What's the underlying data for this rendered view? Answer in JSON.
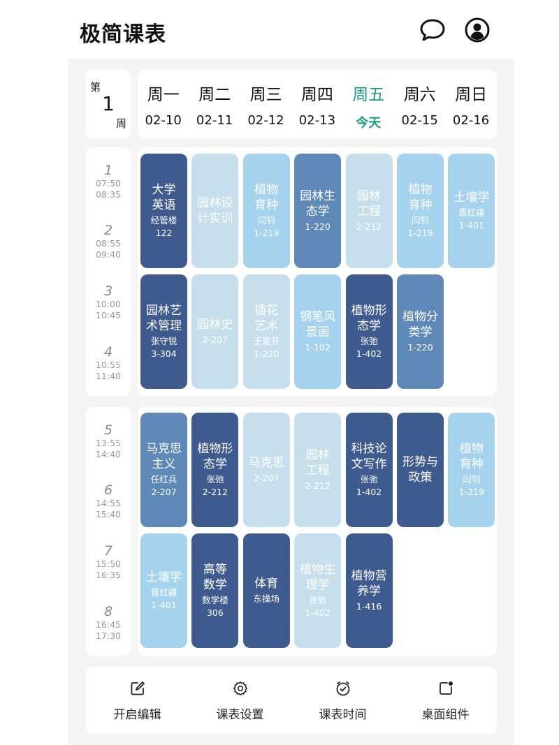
{
  "app": {
    "title": "极简课表"
  },
  "week": {
    "prefix": "第",
    "number": "1",
    "suffix": "周"
  },
  "days": [
    {
      "name": "周一",
      "date": "02-10"
    },
    {
      "name": "周二",
      "date": "02-11"
    },
    {
      "name": "周三",
      "date": "02-12"
    },
    {
      "name": "周四",
      "date": "02-13"
    },
    {
      "name": "周五",
      "date": "今天",
      "today": true
    },
    {
      "name": "周六",
      "date": "02-15"
    },
    {
      "name": "周日",
      "date": "02-16"
    }
  ],
  "periods": [
    {
      "num": "1",
      "start": "07:50",
      "end": "08:35"
    },
    {
      "num": "2",
      "start": "08:55",
      "end": "09:40"
    },
    {
      "num": "3",
      "start": "10:00",
      "end": "10:45"
    },
    {
      "num": "4",
      "start": "10:55",
      "end": "11:40"
    },
    {
      "num": "5",
      "start": "13:55",
      "end": "14:40"
    },
    {
      "num": "6",
      "start": "14:55",
      "end": "15:40"
    },
    {
      "num": "7",
      "start": "15:50",
      "end": "16:35"
    },
    {
      "num": "8",
      "start": "16:45",
      "end": "17:30"
    }
  ],
  "courses": [
    {
      "day": 0,
      "slot": 0,
      "name": "大学英语",
      "teacher": "经管楼",
      "room": "122",
      "color": "navy"
    },
    {
      "day": 1,
      "slot": 0,
      "name": "园林设计实训",
      "teacher": "",
      "room": "",
      "color": "pale"
    },
    {
      "day": 2,
      "slot": 0,
      "name": "植物育种",
      "teacher": "闫钊",
      "room": "1-219",
      "color": "sky"
    },
    {
      "day": 3,
      "slot": 0,
      "name": "园林生态学",
      "teacher": "",
      "room": "1-220",
      "color": "mid"
    },
    {
      "day": 4,
      "slot": 0,
      "name": "园林工程",
      "teacher": "",
      "room": "2-212",
      "color": "pale"
    },
    {
      "day": 5,
      "slot": 0,
      "name": "植物育种",
      "teacher": "闫钊",
      "room": "1-219",
      "color": "sky"
    },
    {
      "day": 6,
      "slot": 0,
      "name": "土壤学",
      "teacher": "晋红疆",
      "room": "1-401",
      "color": "sky"
    },
    {
      "day": 0,
      "slot": 1,
      "name": "园林艺术管理",
      "teacher": "张守锐",
      "room": "3-304",
      "color": "navy"
    },
    {
      "day": 1,
      "slot": 1,
      "name": "园林史",
      "teacher": "",
      "room": "2-207",
      "color": "pale"
    },
    {
      "day": 2,
      "slot": 1,
      "name": "插花艺术",
      "teacher": "王爱芬",
      "room": "1-220",
      "color": "pale"
    },
    {
      "day": 3,
      "slot": 1,
      "name": "钢笔风景画",
      "teacher": "",
      "room": "1-102",
      "color": "sky"
    },
    {
      "day": 4,
      "slot": 1,
      "name": "植物形态学",
      "teacher": "张弛",
      "room": "1-402",
      "color": "navy"
    },
    {
      "day": 5,
      "slot": 1,
      "name": "植物分类学",
      "teacher": "",
      "room": "1-220",
      "color": "mid"
    },
    {
      "day": 0,
      "slot": 2,
      "name": "马克思主义",
      "teacher": "任红兵",
      "room": "2-207",
      "color": "mid"
    },
    {
      "day": 1,
      "slot": 2,
      "name": "植物形态学",
      "teacher": "张弛",
      "room": "2-212",
      "color": "navy"
    },
    {
      "day": 2,
      "slot": 2,
      "name": "马克思",
      "teacher": "",
      "room": "2-207",
      "color": "pale"
    },
    {
      "day": 3,
      "slot": 2,
      "name": "园林工程",
      "teacher": "",
      "room": "2-212",
      "color": "pale"
    },
    {
      "day": 4,
      "slot": 2,
      "name": "科技论文写作",
      "teacher": "张弛",
      "room": "1-402",
      "color": "navy"
    },
    {
      "day": 5,
      "slot": 2,
      "name": "形势与政策",
      "teacher": "",
      "room": "",
      "color": "navy"
    },
    {
      "day": 6,
      "slot": 2,
      "name": "植物育种",
      "teacher": "闫钊",
      "room": "1-219",
      "color": "sky"
    },
    {
      "day": 0,
      "slot": 3,
      "name": "土壤学",
      "teacher": "晋红疆",
      "room": "1-401",
      "color": "sky"
    },
    {
      "day": 1,
      "slot": 3,
      "name": "高等数学",
      "teacher": "数学楼",
      "room": "306",
      "color": "navy"
    },
    {
      "day": 2,
      "slot": 3,
      "name": "体育",
      "teacher": "东操场",
      "room": "",
      "color": "navy"
    },
    {
      "day": 3,
      "slot": 3,
      "name": "植物生理学",
      "teacher": "张弛",
      "room": "1-402",
      "color": "pale"
    },
    {
      "day": 4,
      "slot": 3,
      "name": "植物营养学",
      "teacher": "",
      "room": "1-416",
      "color": "navy"
    }
  ],
  "actions": [
    {
      "label": "开启编辑",
      "icon": "edit-icon"
    },
    {
      "label": "课表设置",
      "icon": "gear-icon"
    },
    {
      "label": "课表时间",
      "icon": "clock-icon"
    },
    {
      "label": "桌面组件",
      "icon": "widget-icon"
    }
  ]
}
